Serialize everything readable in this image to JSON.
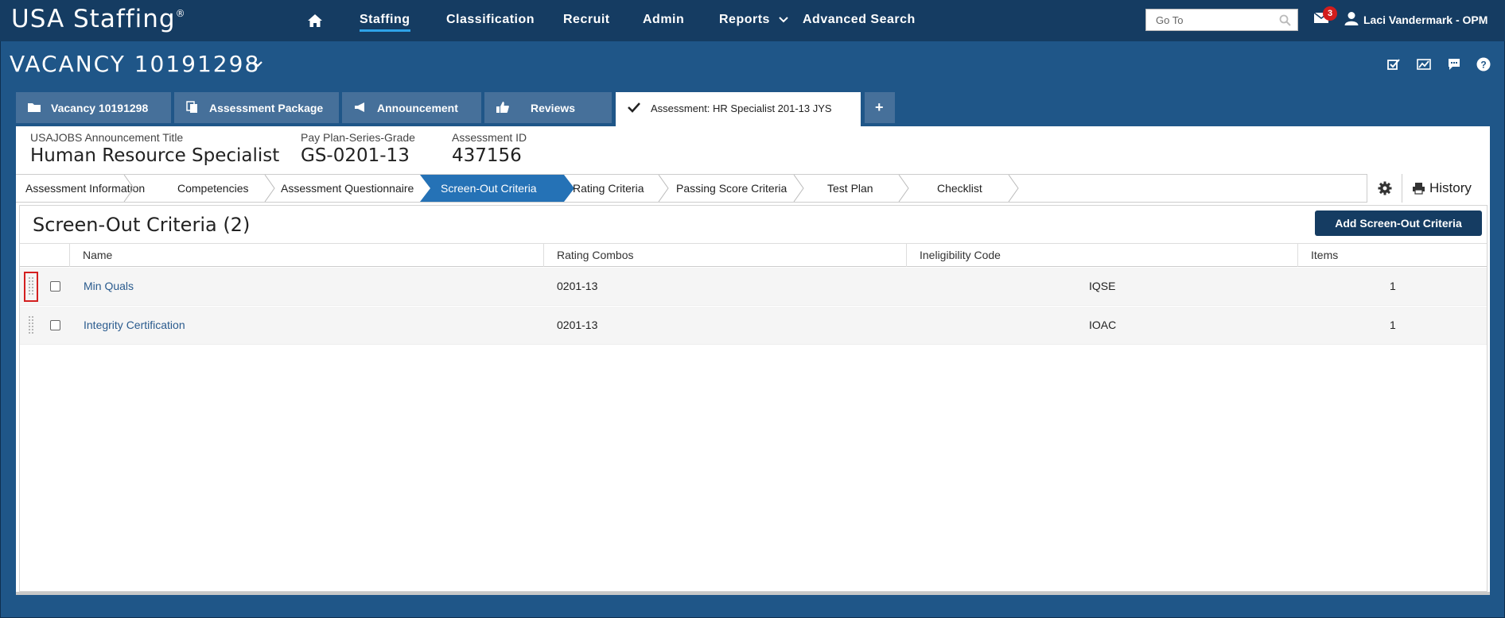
{
  "app": {
    "logo": "USA Staffing",
    "logo_mark": "®"
  },
  "nav": {
    "items": [
      "Staffing",
      "Classification",
      "Recruit",
      "Admin",
      "Reports",
      "Advanced Search"
    ],
    "active": "Staffing",
    "search_placeholder": "Go To",
    "mail_count": "3",
    "user": "Laci Vandermark - OPM"
  },
  "vacancy": {
    "title": "VACANCY 10191298"
  },
  "tabs": [
    {
      "label": "Vacancy 10191298",
      "icon": "folder-icon"
    },
    {
      "label": "Assessment Package",
      "icon": "copy-icon"
    },
    {
      "label": "Announcement",
      "icon": "megaphone-icon"
    },
    {
      "label": "Reviews",
      "icon": "thumbs-up-icon"
    },
    {
      "label": "Assessment: HR Specialist 201-13 JYS",
      "icon": "checkmark-icon"
    },
    {
      "label": "+",
      "icon": "plus-icon"
    }
  ],
  "meta": {
    "title_label": "USAJOBS Announcement Title",
    "title_value": "Human Resource Specialist",
    "pay_label": "Pay Plan-Series-Grade",
    "pay_value": "GS-0201-13",
    "id_label": "Assessment ID",
    "id_value": "437156"
  },
  "steps": {
    "items": [
      "Assessment Information",
      "Competencies",
      "Assessment Questionnaire",
      "Screen-Out Criteria",
      "Rating Criteria",
      "Passing Score Criteria",
      "Test Plan",
      "Checklist"
    ],
    "active": "Screen-Out Criteria",
    "history_label": "History"
  },
  "section": {
    "title": "Screen-Out Criteria (2)",
    "add_button": "Add Screen-Out Criteria"
  },
  "table": {
    "columns": [
      "Name",
      "Rating Combos",
      "Ineligibility Code",
      "Items"
    ],
    "rows": [
      {
        "name": "Min Quals",
        "combos": "0201-13",
        "code": "IQSE",
        "items": "1"
      },
      {
        "name": "Integrity Certification",
        "combos": "0201-13",
        "code": "IOAC",
        "items": "1"
      }
    ]
  },
  "colors": {
    "page_bg": "#1f5688",
    "topbar": "#153c62",
    "tab_bg": "#46709a",
    "accent": "#2572b6",
    "link": "#2a5b8e",
    "badge": "#d21d1d"
  }
}
